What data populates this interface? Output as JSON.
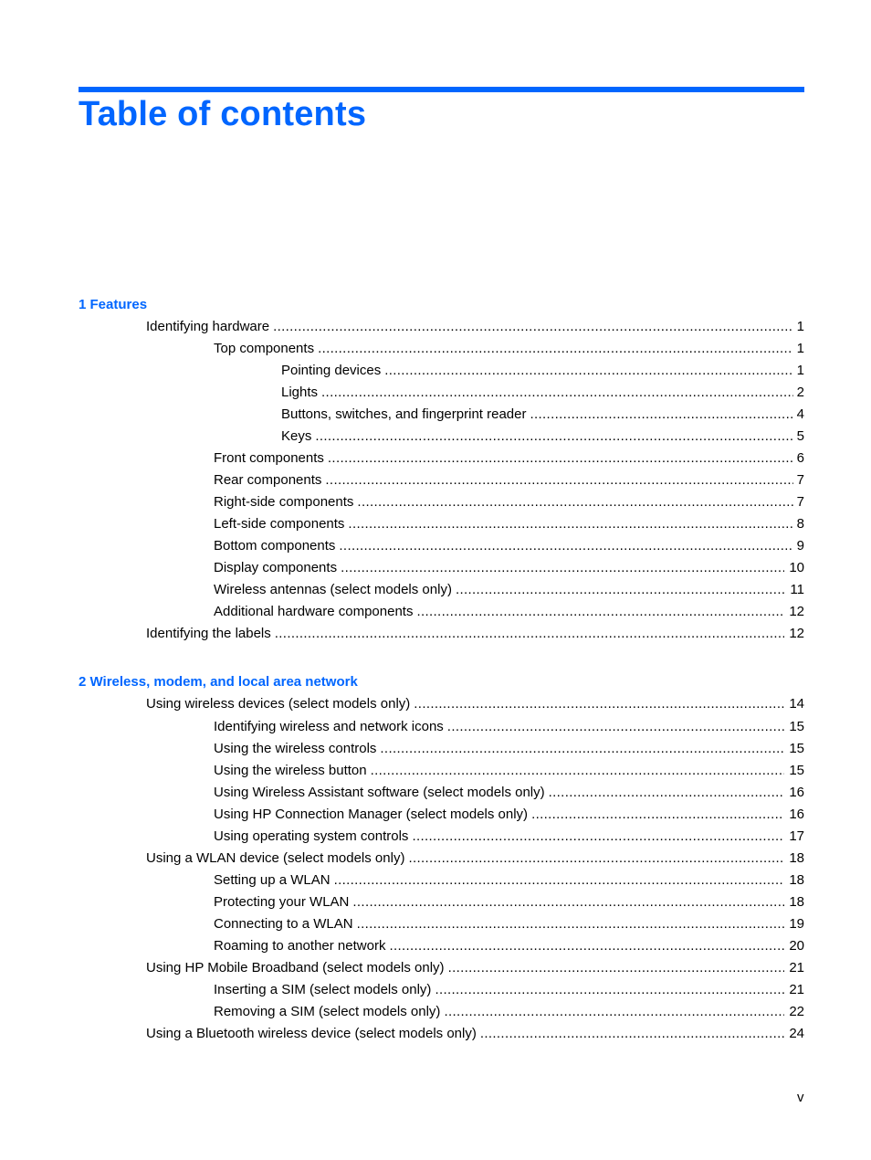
{
  "page_title": "Table of contents",
  "accent_color": "#0066ff",
  "chapters": [
    {
      "heading": "1  Features",
      "entries": [
        {
          "label": "Identifying hardware",
          "page": "1",
          "level": 1
        },
        {
          "label": "Top components",
          "page": "1",
          "level": 2
        },
        {
          "label": "Pointing devices",
          "page": "1",
          "level": 3
        },
        {
          "label": "Lights",
          "page": "2",
          "level": 3
        },
        {
          "label": "Buttons, switches, and fingerprint reader",
          "page": "4",
          "level": 3
        },
        {
          "label": "Keys",
          "page": "5",
          "level": 3
        },
        {
          "label": "Front components",
          "page": "6",
          "level": 2
        },
        {
          "label": "Rear components",
          "page": "7",
          "level": 2
        },
        {
          "label": "Right-side components",
          "page": "7",
          "level": 2
        },
        {
          "label": "Left-side components",
          "page": "8",
          "level": 2
        },
        {
          "label": "Bottom components",
          "page": "9",
          "level": 2
        },
        {
          "label": "Display components",
          "page": "10",
          "level": 2
        },
        {
          "label": "Wireless antennas (select models only)",
          "page": "11",
          "level": 2
        },
        {
          "label": "Additional hardware components",
          "page": "12",
          "level": 2
        },
        {
          "label": "Identifying the labels",
          "page": "12",
          "level": 1
        }
      ]
    },
    {
      "heading": "2  Wireless, modem, and local area network",
      "entries": [
        {
          "label": "Using wireless devices (select models only)",
          "page": "14",
          "level": 1
        },
        {
          "label": "Identifying wireless and network icons",
          "page": "15",
          "level": 2
        },
        {
          "label": "Using the wireless controls",
          "page": "15",
          "level": 2
        },
        {
          "label": "Using the wireless button",
          "page": "15",
          "level": 2
        },
        {
          "label": "Using Wireless Assistant software (select models only)",
          "page": "16",
          "level": 2
        },
        {
          "label": "Using HP Connection Manager (select models only)",
          "page": "16",
          "level": 2
        },
        {
          "label": "Using operating system controls",
          "page": "17",
          "level": 2
        },
        {
          "label": "Using a WLAN device (select models only)",
          "page": "18",
          "level": 1
        },
        {
          "label": "Setting up a WLAN",
          "page": "18",
          "level": 2
        },
        {
          "label": "Protecting your WLAN",
          "page": "18",
          "level": 2
        },
        {
          "label": "Connecting to a WLAN",
          "page": "19",
          "level": 2
        },
        {
          "label": "Roaming to another network",
          "page": "20",
          "level": 2
        },
        {
          "label": "Using HP Mobile Broadband (select models only)",
          "page": "21",
          "level": 1
        },
        {
          "label": "Inserting a SIM (select models only)",
          "page": "21",
          "level": 2
        },
        {
          "label": "Removing a SIM (select models only)",
          "page": "22",
          "level": 2
        },
        {
          "label": "Using a Bluetooth wireless device (select models only)",
          "page": "24",
          "level": 1
        }
      ]
    }
  ],
  "footer": {
    "page_number": "v"
  }
}
